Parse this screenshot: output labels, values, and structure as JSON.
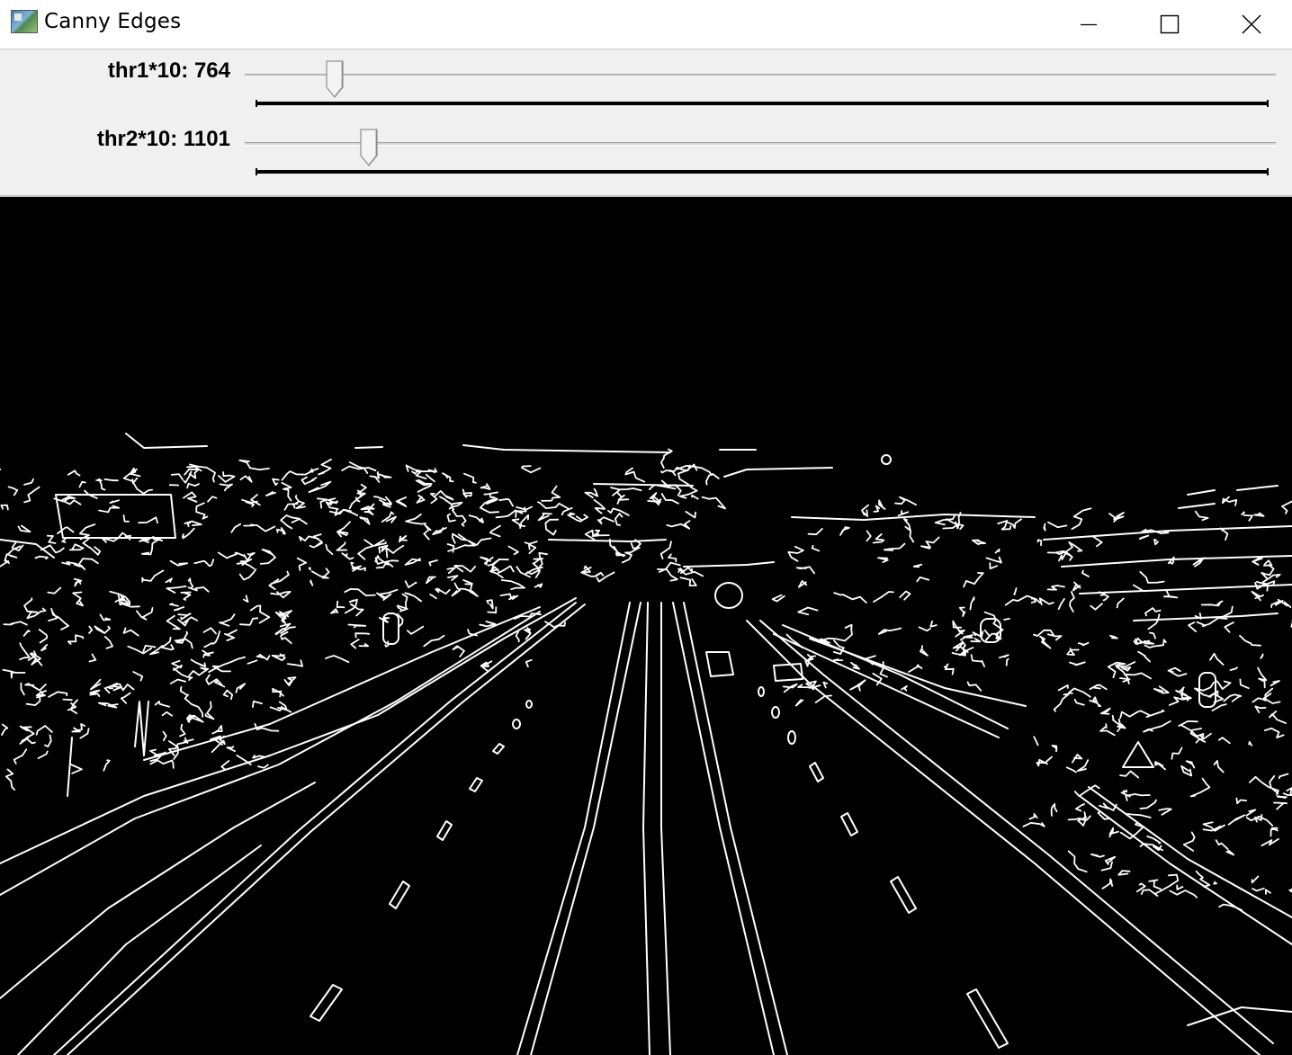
{
  "window": {
    "title": "Canny Edges",
    "app_icon": "opencv-window-icon",
    "buttons": {
      "minimize": "minimize-icon",
      "maximize": "maximize-icon",
      "close": "close-icon"
    }
  },
  "trackbars": [
    {
      "label": "thr1*10: 764",
      "value": 764,
      "position_fraction": 0.087
    },
    {
      "label": "thr2*10: 1101",
      "value": 1101,
      "position_fraction": 0.12
    }
  ],
  "canvas": {
    "background": "#000000",
    "edge_color": "#ffffff",
    "content": "canny-edge-output"
  }
}
